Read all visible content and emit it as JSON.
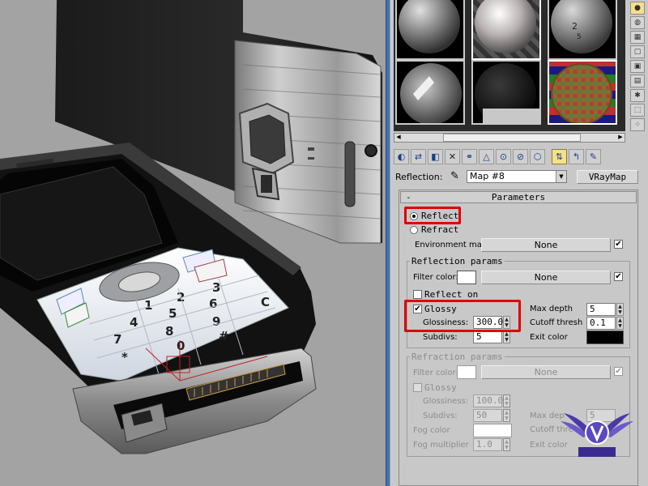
{
  "reflection_row": {
    "label": "Reflection:",
    "map_name": "Map #8",
    "map_type_button": "VRayMap"
  },
  "rollout": {
    "title": "Parameters",
    "minus": "-"
  },
  "mode": {
    "reflect_label": "Reflect",
    "refract_label": "Refract",
    "selected": "Reflect"
  },
  "environment": {
    "label": "Environment map:",
    "map_button": "None",
    "checked": true
  },
  "reflection_params": {
    "title": "Reflection params",
    "filter_color_label": "Filter color:",
    "filter_color": "#ffffff",
    "filter_map": "None",
    "filter_map_checked": true,
    "reflect_on_label": "Reflect on",
    "reflect_on_checked": false,
    "glossy_label": "Glossy",
    "glossy_checked": true,
    "glossiness_label": "Glossiness:",
    "glossiness_value": "300.0",
    "subdivs_label": "Subdivs:",
    "subdivs_value": "5",
    "max_depth_label": "Max depth",
    "max_depth_value": "5",
    "cutoff_label": "Cutoff thresh",
    "cutoff_value": "0.1",
    "exit_color_label": "Exit color",
    "exit_color": "#000000"
  },
  "refraction_params": {
    "title": "Refraction params",
    "filter_color_label": "Filter color:",
    "filter_color": "#ffffff",
    "filter_map": "None",
    "filter_map_checked": true,
    "glossy_label": "Glossy",
    "glossy_checked": false,
    "glossiness_label": "Glossiness:",
    "glossiness_value": "100.0",
    "subdivs_label": "Subdivs:",
    "subdivs_value": "50",
    "max_depth_label": "Max dep",
    "max_depth_value": "5",
    "cutoff_label": "Cutoff thre",
    "fog_color_label": "Fog color",
    "fog_color": "#ffffff",
    "fog_multiplier_label": "Fog multiplier",
    "fog_multiplier_value": "1.0",
    "exit_color_label": "Exit color"
  },
  "phone": {
    "keys": [
      "1",
      "2",
      "3",
      "4",
      "5",
      "6",
      "7",
      "8",
      "9",
      "*",
      "0",
      "#",
      "C"
    ],
    "screen_color": "#1a1a1a"
  },
  "icons": {
    "material_slot": "sphere-preview-icon",
    "toolbar": [
      "get-material-icon",
      "put-to-scene-icon",
      "assign-material-icon",
      "delete-icon",
      "make-unique-icon",
      "put-to-library-icon",
      "material-id-icon",
      "show-map-icon",
      "show-end-result-icon",
      "go-to-parent-icon",
      "go-forward-icon"
    ],
    "eyedropper": "eyedropper-icon",
    "logo": "winged-v-logo"
  },
  "colors": {
    "accent_highlight": "#e00000",
    "panel_bg": "#c8c8c8",
    "viewport_bg": "#a3a3a3",
    "divider": "#4a6fa8"
  }
}
